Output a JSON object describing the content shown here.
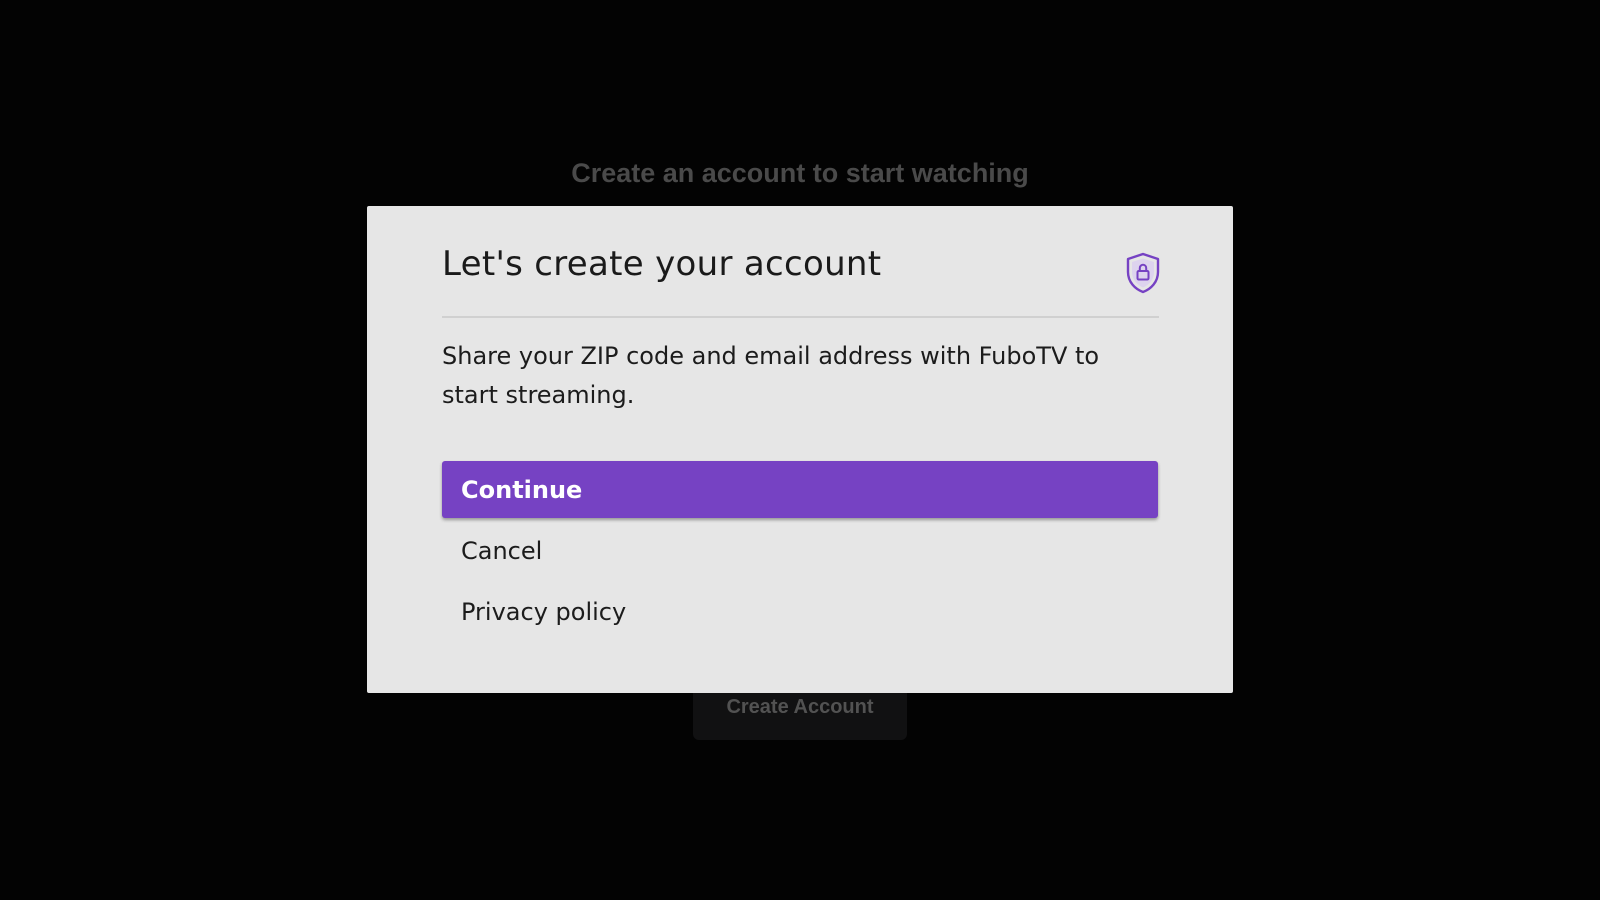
{
  "background": {
    "heading": "Create an account to start watching",
    "button_label": "Create Account"
  },
  "dialog": {
    "title": "Let's create your account",
    "icon": "shield-lock-icon",
    "description": "Share your ZIP code and email address with FuboTV to start streaming.",
    "options": [
      {
        "label": "Continue",
        "selected": true
      },
      {
        "label": "Cancel",
        "selected": false
      },
      {
        "label": "Privacy policy",
        "selected": false
      }
    ]
  },
  "colors": {
    "accent": "#7642c3",
    "dialog_bg": "#e6e6e6",
    "page_bg": "#030303"
  }
}
